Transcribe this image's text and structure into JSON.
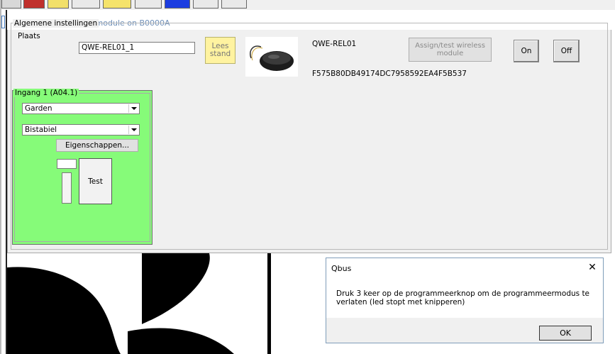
{
  "window": {
    "title": "QWE-REL01 wireless module on B0000A"
  },
  "general": {
    "group_label": "Algemene instellingen",
    "location_label": "Plaats",
    "location_value": "QWE-REL01_1",
    "read_status_label": "Lees\nstand",
    "module_name": "QWE-REL01",
    "module_id": "F575B80DB49174DC7958592EA4F5B537",
    "assign_label": "Assign/test wireless\nmodule",
    "on_label": "On",
    "off_label": "Off"
  },
  "input1": {
    "group_label": "Ingang 1 (A04.1)",
    "select_room": "Garden",
    "select_mode": "Bistabiel",
    "properties_label": "Eigenschappen...",
    "test_label": "Test"
  },
  "dialog": {
    "title": "Qbus",
    "close_glyph": "✕",
    "message": "Druk 3 keer op de programmeerknop om de programmeermodus te verlaten (led stopt met knipperen)",
    "ok_label": "OK"
  },
  "colors": {
    "green_panel": "#86fb79",
    "title_text": "#6e8fb8",
    "read_button": "#fff3a0"
  }
}
